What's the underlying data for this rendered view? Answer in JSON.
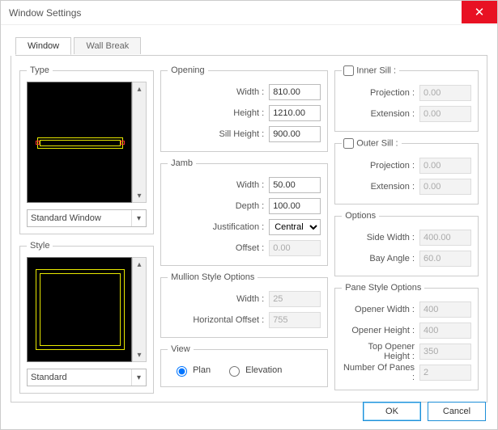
{
  "window": {
    "title": "Window Settings"
  },
  "tabs": {
    "active": "Window",
    "other": "Wall Break"
  },
  "type": {
    "legend": "Type",
    "selected": "Standard Window"
  },
  "style": {
    "legend": "Style",
    "selected": "Standard"
  },
  "opening": {
    "legend": "Opening",
    "width_label": "Width :",
    "width": "810.00",
    "height_label": "Height :",
    "height": "1210.00",
    "sill_label": "Sill Height :",
    "sill": "900.00"
  },
  "jamb": {
    "legend": "Jamb",
    "width_label": "Width :",
    "width": "50.00",
    "depth_label": "Depth :",
    "depth": "100.00",
    "just_label": "Justification :",
    "just": "Central",
    "offset_label": "Offset :",
    "offset": "0.00"
  },
  "mullion": {
    "legend": "Mullion Style Options",
    "width_label": "Width :",
    "width": "25",
    "hoff_label": "Horizontal Offset :",
    "hoff": "755"
  },
  "view": {
    "legend": "View",
    "plan": "Plan",
    "elevation": "Elevation"
  },
  "inner_sill": {
    "legend": "Inner Sill :",
    "proj_label": "Projection :",
    "proj": "0.00",
    "ext_label": "Extension :",
    "ext": "0.00"
  },
  "outer_sill": {
    "legend": "Outer Sill :",
    "proj_label": "Projection :",
    "proj": "0.00",
    "ext_label": "Extension :",
    "ext": "0.00"
  },
  "options": {
    "legend": "Options",
    "side_label": "Side Width :",
    "side": "400.00",
    "bay_label": "Bay Angle :",
    "bay": "60.0"
  },
  "pane": {
    "legend": "Pane Style Options",
    "ow_label": "Opener Width :",
    "ow": "400",
    "oh_label": "Opener Height :",
    "oh": "400",
    "toh_label": "Top Opener Height :",
    "toh": "350",
    "np_label": "Number Of Panes :",
    "np": "2"
  },
  "buttons": {
    "ok": "OK",
    "cancel": "Cancel"
  }
}
